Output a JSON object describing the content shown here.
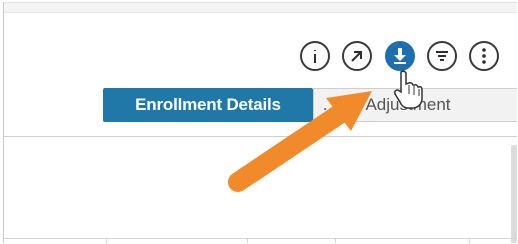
{
  "toolbar": {
    "buttons": [
      {
        "name": "info-button",
        "icon": "info-icon"
      },
      {
        "name": "open-external-button",
        "icon": "arrow-up-right-icon"
      },
      {
        "name": "download-button",
        "icon": "download-icon",
        "active": true
      },
      {
        "name": "filter-button",
        "icon": "filter-icon"
      },
      {
        "name": "more-options-button",
        "icon": "vertical-dots-icon"
      }
    ],
    "active_color": "#1d6fb0"
  },
  "tabs": {
    "primary_label": "Enrollment Details",
    "secondary_label_visible": "…ual Adjustment",
    "primary_color": "#1f78a8"
  },
  "annotation": {
    "arrow_color": "#f08a2b",
    "cursor": "hand-pointer-icon"
  }
}
